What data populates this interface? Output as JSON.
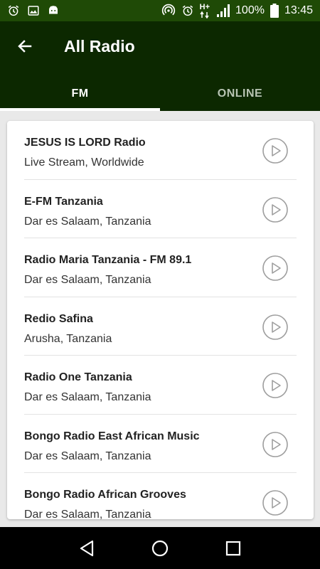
{
  "status_bar": {
    "battery_percent": "100%",
    "time": "13:45",
    "network_label": "H+",
    "icons_left": [
      "alarm-icon",
      "image-icon",
      "android-icon"
    ],
    "icons_right": [
      "hotspot-icon",
      "alarm-icon",
      "data-arrows-icon",
      "signal-icon",
      "battery-icon"
    ]
  },
  "app_bar": {
    "title": "All Radio",
    "back_icon": "arrow-left-icon"
  },
  "tabs": [
    {
      "label": "FM",
      "active": true
    },
    {
      "label": "ONLINE",
      "active": false
    }
  ],
  "stations": [
    {
      "name": "JESUS IS LORD Radio",
      "location": "Live Stream, Worldwide"
    },
    {
      "name": "E-FM Tanzania",
      "location": "Dar es Salaam, Tanzania"
    },
    {
      "name": "Radio Maria Tanzania - FM 89.1",
      "location": "Dar es Salaam, Tanzania"
    },
    {
      "name": "Redio Safina",
      "location": "Arusha, Tanzania"
    },
    {
      "name": "Radio One Tanzania",
      "location": "Dar es Salaam, Tanzania"
    },
    {
      "name": "Bongo Radio East African Music",
      "location": "Dar es Salaam, Tanzania"
    },
    {
      "name": "Bongo Radio African Grooves",
      "location": "Dar es Salaam, Tanzania"
    }
  ],
  "nav_bar": {
    "buttons": [
      "back-triangle-icon",
      "home-circle-icon",
      "recents-square-icon"
    ]
  },
  "colors": {
    "status_bar": "#1f4a06",
    "app_bar": "#0c2800",
    "tab_indicator": "#ffffff",
    "background": "#e9e9e9"
  }
}
